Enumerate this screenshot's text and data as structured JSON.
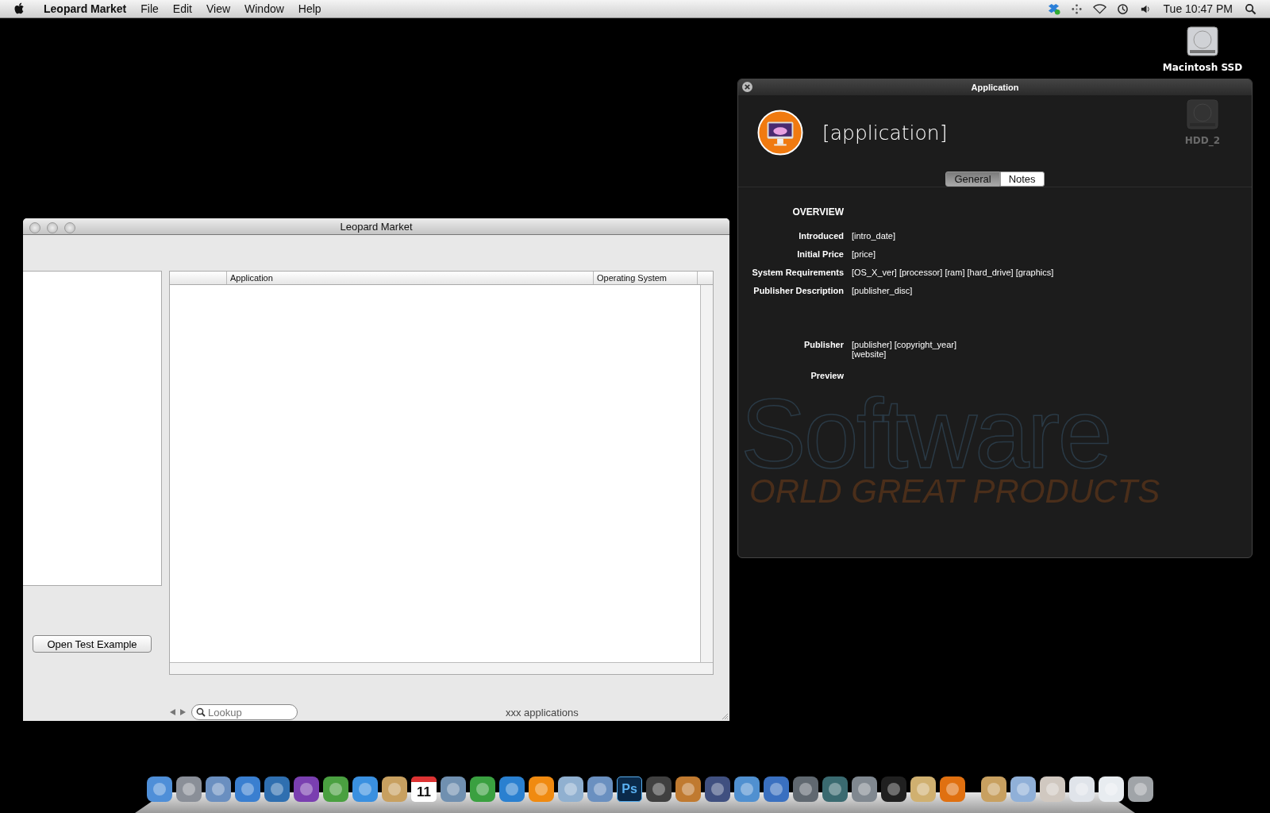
{
  "menu_bar": {
    "app_name": "Leopard Market",
    "menus": [
      "File",
      "Edit",
      "View",
      "Window",
      "Help"
    ],
    "clock": "Tue 10:47 PM"
  },
  "desktop_icons": [
    {
      "label": "Macintosh SSD",
      "dimmed": false
    },
    {
      "label": "HDD_2",
      "dimmed": true
    }
  ],
  "main_window": {
    "title": "Leopard Market",
    "table": {
      "columns": [
        "",
        "Application",
        "Operating System"
      ]
    },
    "button": "Open Test Example",
    "search": {
      "placeholder": "Lookup"
    },
    "count": "xxx applications"
  },
  "info_panel": {
    "title": "Application",
    "name": "[application]",
    "tabs": [
      {
        "label": "General",
        "selected": true
      },
      {
        "label": "Notes",
        "selected": false
      }
    ],
    "section": "OVERVIEW",
    "fields": [
      {
        "label": "Introduced",
        "value": "[intro_date]"
      },
      {
        "label": "Initial Price",
        "value": "[price]"
      },
      {
        "label": "System Requirements",
        "value": "[OS_X_ver] [processor] [ram] [hard_drive] [graphics]"
      },
      {
        "label": "Publisher Description",
        "value": "[publisher_disc]"
      }
    ],
    "fields_2": [
      {
        "label": "Publisher",
        "value": "[publisher] [copyright_year]",
        "value_2": "[website]"
      },
      {
        "label": "Preview"
      }
    ],
    "backdrop_title": "Software",
    "backdrop_subtitle": "ORLD GREAT PRODUCTS"
  },
  "dock": {
    "calendar_day": "11",
    "photoshop_label": "Ps"
  }
}
